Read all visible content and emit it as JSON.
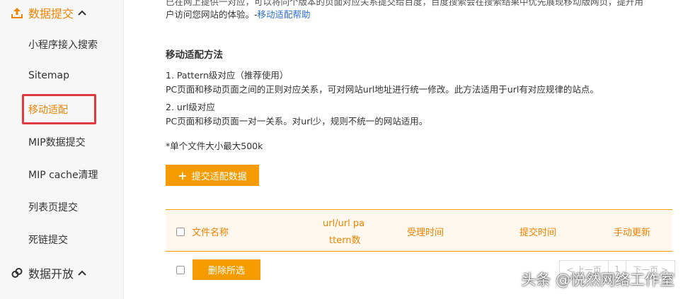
{
  "sidebar": {
    "data_submit": "数据提交",
    "items": [
      {
        "label": "小程序接入搜索"
      },
      {
        "label": "Sitemap"
      },
      {
        "label": "移动适配"
      },
      {
        "label": "MIP数据提交"
      },
      {
        "label": "MIP cache清理"
      },
      {
        "label": "列表页提交"
      },
      {
        "label": "死链提交"
      }
    ],
    "data_open": "数据开放"
  },
  "intro": {
    "line1": "已在网上提供一对应，可以将同个版本的页面对应关系提交给百度，百度搜索会在搜索结果中优先展现移动版网页，提升用",
    "line2_text": "户访问您网站的体验。-",
    "help_link": "移动适配帮助"
  },
  "method": {
    "title": "移动适配方法",
    "option1_title": "1. Pattern级对应（推荐使用）",
    "option1_desc": "PC页面和移动页面之间的正则对应关系，可对网站url地址进行统一修改。此方法适用于url有对应规律的站点。",
    "option2_title": "2. url级对应",
    "option2_desc": "PC页面和移动页面一对一关系。对url少，规则不统一的网站适用。",
    "size_note": "*单个文件大小最大500k"
  },
  "submit_button": "提交适配数据",
  "table": {
    "headers": {
      "file_name": "文件名称",
      "url_count_line1": "url/url pa",
      "url_count_line2": "ttern数",
      "accepted_time": "受理时间",
      "submit_time": "提交时间",
      "manual_update": "手动更新"
    }
  },
  "delete_button": "删除所选",
  "pagination": {
    "prev": "< 上一页",
    "page": "1",
    "next": "下一页 >"
  },
  "watermark": "头条 @悦然网络工作室",
  "colors": {
    "accent": "#f59b00",
    "accent_text": "#f08300",
    "highlight_box": "#e0393e",
    "link": "#2b6cd4"
  }
}
